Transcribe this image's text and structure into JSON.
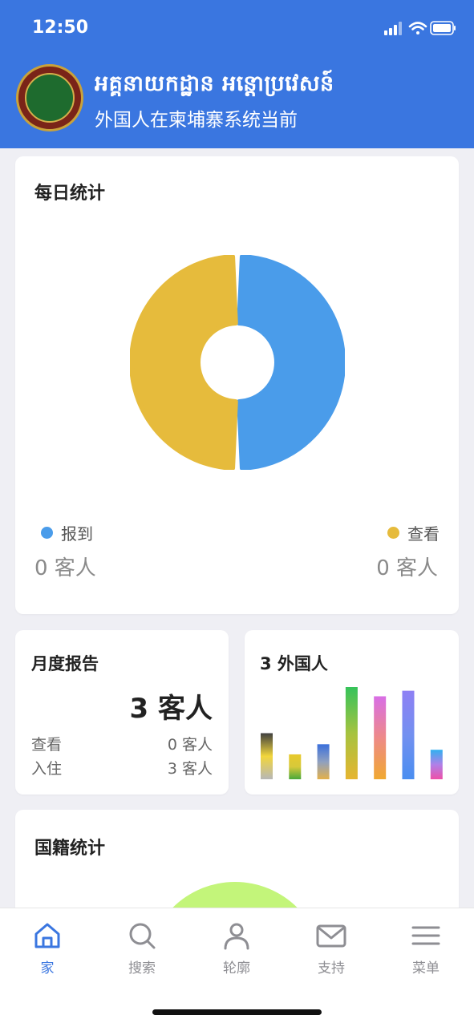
{
  "status_bar": {
    "time": "12:50"
  },
  "header": {
    "title_km": "អគ្គនាយកដ្ឋាន អន្តោប្រវេសន៍",
    "title_zh": "外国人在柬埔寨系统当前"
  },
  "daily": {
    "title": "每日统计",
    "checkin_label": "报到",
    "view_label": "查看",
    "checkin_count": "0 客人",
    "view_count": "0 客人",
    "colors": {
      "checkin": "#4a9cea",
      "view": "#e6bb3c"
    }
  },
  "monthly": {
    "title": "月度报告",
    "total": "3 客人",
    "view_label": "查看",
    "view_value": "0 客人",
    "stay_label": "入住",
    "stay_value": "3 客人"
  },
  "foreign": {
    "title": "3 外国人"
  },
  "nationality": {
    "title": "国籍统计"
  },
  "tabs": [
    {
      "label": "家",
      "icon": "home-icon"
    },
    {
      "label": "搜索",
      "icon": "search-icon"
    },
    {
      "label": "轮廓",
      "icon": "profile-icon"
    },
    {
      "label": "支持",
      "icon": "mail-icon"
    },
    {
      "label": "菜单",
      "icon": "menu-icon"
    }
  ],
  "chart_data": [
    {
      "type": "pie",
      "categories": [
        "报到",
        "查看"
      ],
      "values": [
        1,
        1
      ],
      "colors": [
        "#4a9cea",
        "#e6bb3c"
      ],
      "donut": true
    },
    {
      "type": "bar",
      "values": [
        50,
        27,
        38,
        100,
        90,
        96,
        32
      ],
      "ylim": [
        0,
        100
      ]
    }
  ]
}
